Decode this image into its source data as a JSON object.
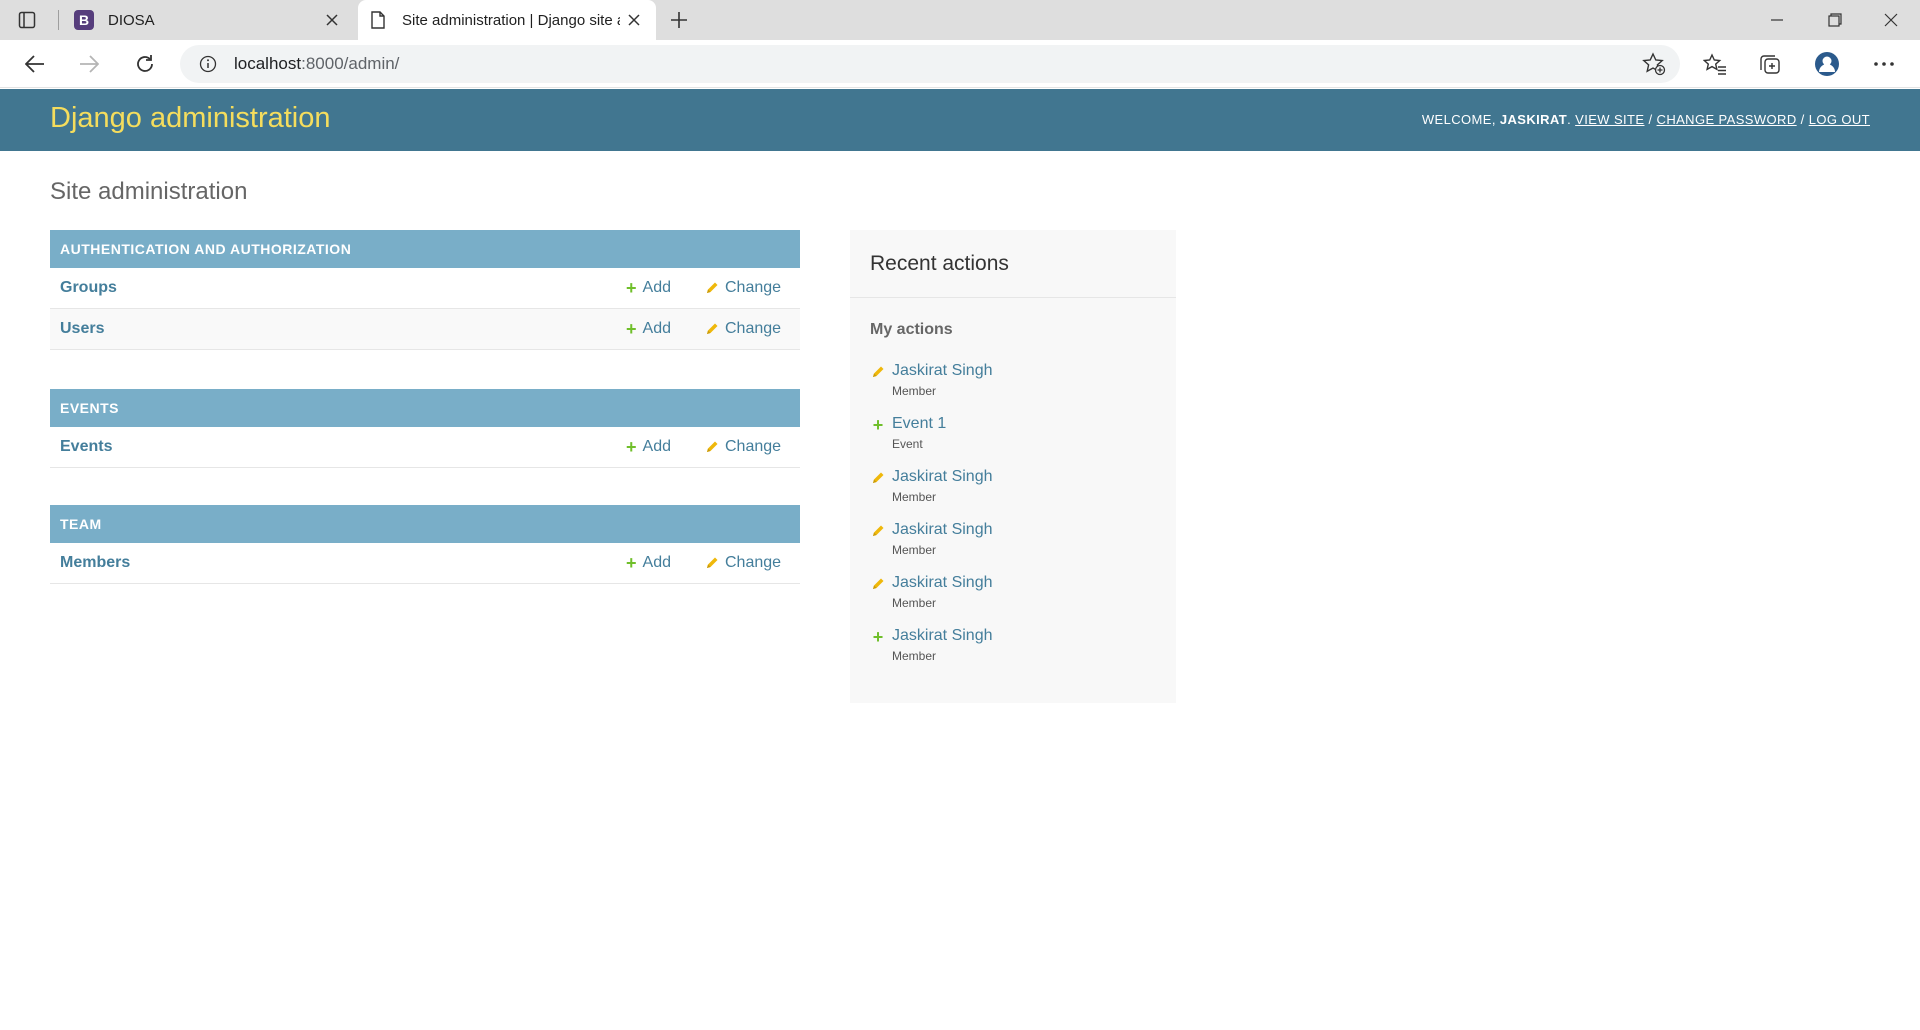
{
  "browser": {
    "tabs": [
      {
        "title": "DIOSA",
        "favicon": "B",
        "active": false
      },
      {
        "title": "Site administration | Django site admin",
        "favicon": "page-icon",
        "active": true
      }
    ],
    "url_host": "localhost",
    "url_rest": ":8000/admin/"
  },
  "header": {
    "branding": "Django administration",
    "welcome": "WELCOME,",
    "username": "JASKIRAT",
    "dot": ".",
    "view_site": "VIEW SITE",
    "change_password": "CHANGE PASSWORD",
    "log_out": "LOG OUT",
    "sep": "/"
  },
  "content": {
    "title": "Site administration",
    "add_label": "Add",
    "change_label": "Change",
    "modules": [
      {
        "caption": "AUTHENTICATION AND AUTHORIZATION",
        "models": [
          "Groups",
          "Users"
        ]
      },
      {
        "caption": "EVENTS",
        "models": [
          "Events"
        ]
      },
      {
        "caption": "TEAM",
        "models": [
          "Members"
        ]
      }
    ]
  },
  "recent": {
    "title": "Recent actions",
    "subtitle": "My actions",
    "actions": [
      {
        "kind": "change",
        "title": "Jaskirat Singh",
        "type": "Member"
      },
      {
        "kind": "add",
        "title": "Event 1",
        "type": "Event"
      },
      {
        "kind": "change",
        "title": "Jaskirat Singh",
        "type": "Member"
      },
      {
        "kind": "change",
        "title": "Jaskirat Singh",
        "type": "Member"
      },
      {
        "kind": "change",
        "title": "Jaskirat Singh",
        "type": "Member"
      },
      {
        "kind": "add",
        "title": "Jaskirat Singh",
        "type": "Member"
      }
    ]
  },
  "colors": {
    "header_bg": "#417690",
    "branding": "#f5dd5d",
    "caption_bg": "#79aec8",
    "link": "#447e9b",
    "add_icon": "#70bf2b",
    "change_icon": "#efb80b"
  }
}
